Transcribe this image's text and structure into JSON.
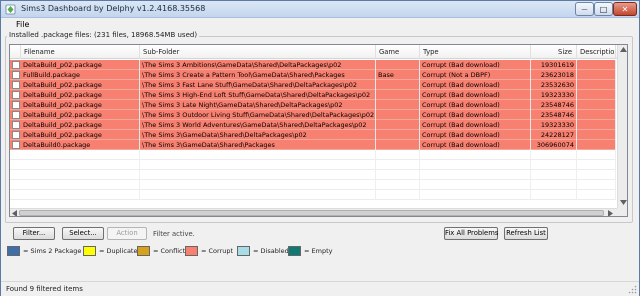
{
  "window": {
    "title": "Sims3 Dashboard by Delphy v1.2.4168.35568",
    "min_glyph": "—",
    "max_glyph": "□",
    "close_glyph": "✕"
  },
  "menu": {
    "file": "File"
  },
  "group": {
    "label": "Installed .package files: (231 files, 18968.54MB used)"
  },
  "table": {
    "columns": [
      "Filename",
      "Sub-Folder",
      "Game",
      "Type",
      "Size",
      "Description"
    ],
    "rows": [
      {
        "filename": "DeltaBuild_p02.package",
        "subfolder": "\\The Sims 3 Ambitions\\GameData\\Shared\\DeltaPackages\\p02",
        "game": "",
        "type": "Corrupt (Bad download)",
        "size": "19301619",
        "description": ""
      },
      {
        "filename": "FullBuild.package",
        "subfolder": "\\The Sims 3 Create a Pattern Tool\\GameData\\Shared\\Packages",
        "game": "Base",
        "type": "Corrupt (Not a DBPF)",
        "size": "23623018",
        "description": ""
      },
      {
        "filename": "DeltaBuild_p02.package",
        "subfolder": "\\The Sims 3 Fast Lane Stuff\\GameData\\Shared\\DeltaPackages\\p02",
        "game": "",
        "type": "Corrupt (Bad download)",
        "size": "23532630",
        "description": ""
      },
      {
        "filename": "DeltaBuild_p02.package",
        "subfolder": "\\The Sims 3 High-End Loft Stuff\\GameData\\Shared\\DeltaPackages\\p02",
        "game": "",
        "type": "Corrupt (Bad download)",
        "size": "19323330",
        "description": ""
      },
      {
        "filename": "DeltaBuild_p02.package",
        "subfolder": "\\The Sims 3 Late Night\\GameData\\Shared\\DeltaPackages\\p02",
        "game": "",
        "type": "Corrupt (Bad download)",
        "size": "23548746",
        "description": ""
      },
      {
        "filename": "DeltaBuild_p02.package",
        "subfolder": "\\The Sims 3 Outdoor Living Stuff\\GameData\\Shared\\DeltaPackages\\p02",
        "game": "",
        "type": "Corrupt (Bad download)",
        "size": "23548746",
        "description": ""
      },
      {
        "filename": "DeltaBuild_p02.package",
        "subfolder": "\\The Sims 3 World Adventures\\GameData\\Shared\\DeltaPackages\\p02",
        "game": "",
        "type": "Corrupt (Bad download)",
        "size": "19323330",
        "description": ""
      },
      {
        "filename": "DeltaBuild_p02.package",
        "subfolder": "\\The Sims 3\\GameData\\Shared\\DeltaPackages\\p02",
        "game": "",
        "type": "Corrupt (Bad download)",
        "size": "24228127",
        "description": ""
      },
      {
        "filename": "DeltaBuild0.package",
        "subfolder": "\\The Sims 3\\GameData\\Shared\\Packages",
        "game": "",
        "type": "Corrupt (Bad download)",
        "size": "306960074",
        "description": ""
      }
    ],
    "row_color": "#f88070"
  },
  "buttons": {
    "filter": "Filter...",
    "select": "Select...",
    "action": "Action",
    "fix_all": "Fix All Problems",
    "refresh": "Refresh List"
  },
  "filter_status": "Filter active.",
  "legend": [
    {
      "label": "= Sims 2 Package",
      "color": "#3f6fa8"
    },
    {
      "label": "= Duplicate",
      "color": "#ffff00"
    },
    {
      "label": "= Conflict",
      "color": "#d6a21e"
    },
    {
      "label": "= Corrupt",
      "color": "#f88070"
    },
    {
      "label": "= Disabled",
      "color": "#a8dde8"
    },
    {
      "label": "= Empty",
      "color": "#0f7a73"
    }
  ],
  "status": {
    "text": "Found 9 filtered items"
  }
}
